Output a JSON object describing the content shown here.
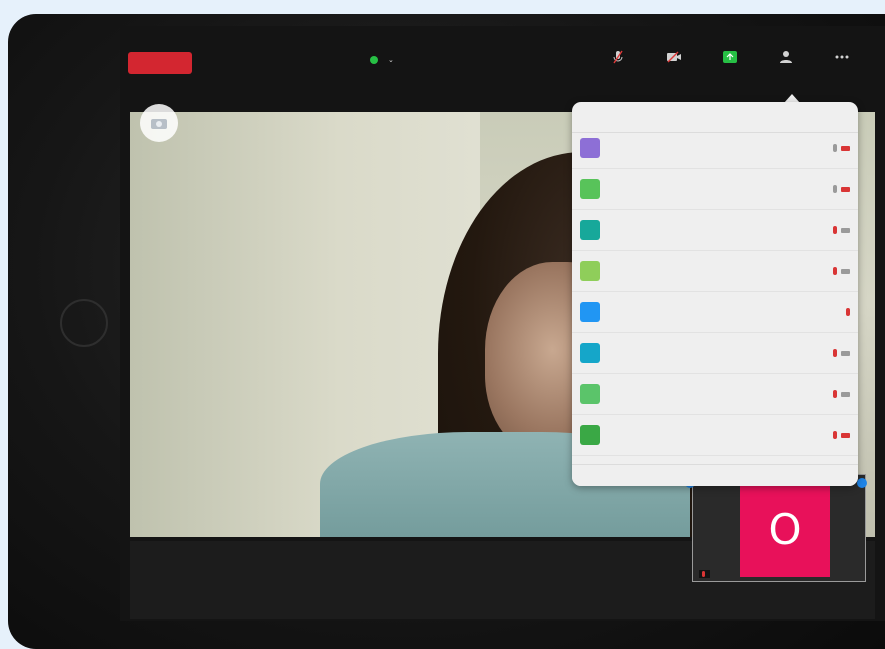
{
  "status_bar": {
    "time": "",
    "battery": ""
  },
  "meeting": {
    "leave_label": "",
    "title": ""
  },
  "toolbar": {
    "items": [
      {
        "name": "mic",
        "label": ""
      },
      {
        "name": "video",
        "label": ""
      },
      {
        "name": "share",
        "label": "",
        "active": true
      },
      {
        "name": "participants",
        "label": ""
      },
      {
        "name": "more",
        "label": ""
      }
    ]
  },
  "participants_panel": {
    "title": "",
    "invite_label": "",
    "rows": [
      {
        "initial": "",
        "name": "",
        "color": "#8d6fd6",
        "mic": "grey",
        "cam": "red"
      },
      {
        "initial": "",
        "name": "",
        "color": "#58c35a",
        "mic": "grey",
        "cam": "red"
      },
      {
        "initial": "",
        "name": "",
        "color": "#17a89a",
        "mic": "red",
        "cam": "grey"
      },
      {
        "initial": "",
        "name": "",
        "color": "#8fce5a",
        "mic": "red",
        "cam": "grey"
      },
      {
        "initial": "",
        "name": "",
        "color": "#2196f3",
        "mic": "red",
        "cam": "none"
      },
      {
        "initial": "",
        "name": "",
        "color": "#15a6c9",
        "mic": "red",
        "cam": "grey"
      },
      {
        "initial": "",
        "name": "",
        "color": "#5bc46a",
        "mic": "red",
        "cam": "grey"
      },
      {
        "initial": "",
        "name": "",
        "color": "#3aa845",
        "mic": "red",
        "cam": "red"
      },
      {
        "initial": "",
        "name": "",
        "color": "#28b7d6",
        "mic": "none",
        "cam": "none"
      }
    ]
  },
  "thumbnail": {
    "letter": "O",
    "name": "",
    "tile_color": "#e8115a"
  }
}
